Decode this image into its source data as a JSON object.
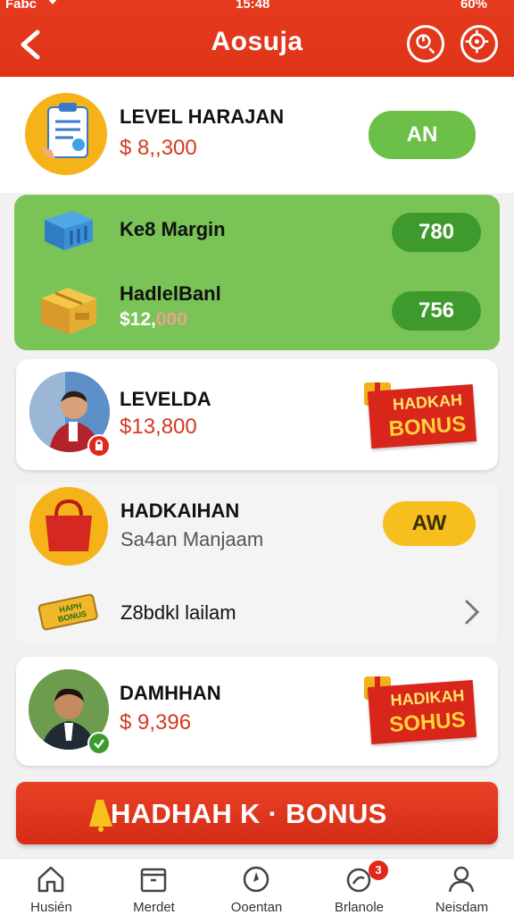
{
  "status_bar": {
    "carrier": "Fabc",
    "time": "15:48",
    "battery": "60%"
  },
  "header": {
    "title": "Aosuja"
  },
  "level_card": {
    "title": "LEVEL HARAJAN",
    "amount": "$ 8,,300",
    "button": "AN"
  },
  "green_card": {
    "row1": {
      "title": "Ke8 Margin",
      "badge": "780"
    },
    "row2": {
      "title": "HadlelBanl",
      "amount_main": "$12,",
      "amount_faded": "000",
      "badge": "756"
    }
  },
  "person_card_1": {
    "title": "LEVELDA",
    "amount": "$13,800",
    "tag_line1": "HADKAH",
    "tag_line2": "BONUS"
  },
  "shopping_card": {
    "title": "HADKAIHAN",
    "subtitle": "Sa4an Manjaam",
    "button": "AW",
    "ticket_text": "HAPH BONUS",
    "row2_label": "Z8bdkl lailam"
  },
  "person_card_2": {
    "title": "DAMHHAN",
    "amount": "$ 9,396",
    "tag_line1": "HADIKAH",
    "tag_line2": "SOHUS"
  },
  "bonus_bar": {
    "label": "HADHAH K · BONUS"
  },
  "bottom_nav": [
    {
      "label": "Husién",
      "icon": "home-icon"
    },
    {
      "label": "Merdet",
      "icon": "calendar-icon"
    },
    {
      "label": "Ooentan",
      "icon": "compass-icon"
    },
    {
      "label": "Brlanole",
      "icon": "wallet-icon",
      "badge": "3"
    },
    {
      "label": "Neisdam",
      "icon": "profile-icon"
    }
  ],
  "colors": {
    "brand_red": "#e53a1e",
    "green": "#7ac356",
    "button_green": "#6cc048",
    "yellow": "#f7bf1d"
  }
}
